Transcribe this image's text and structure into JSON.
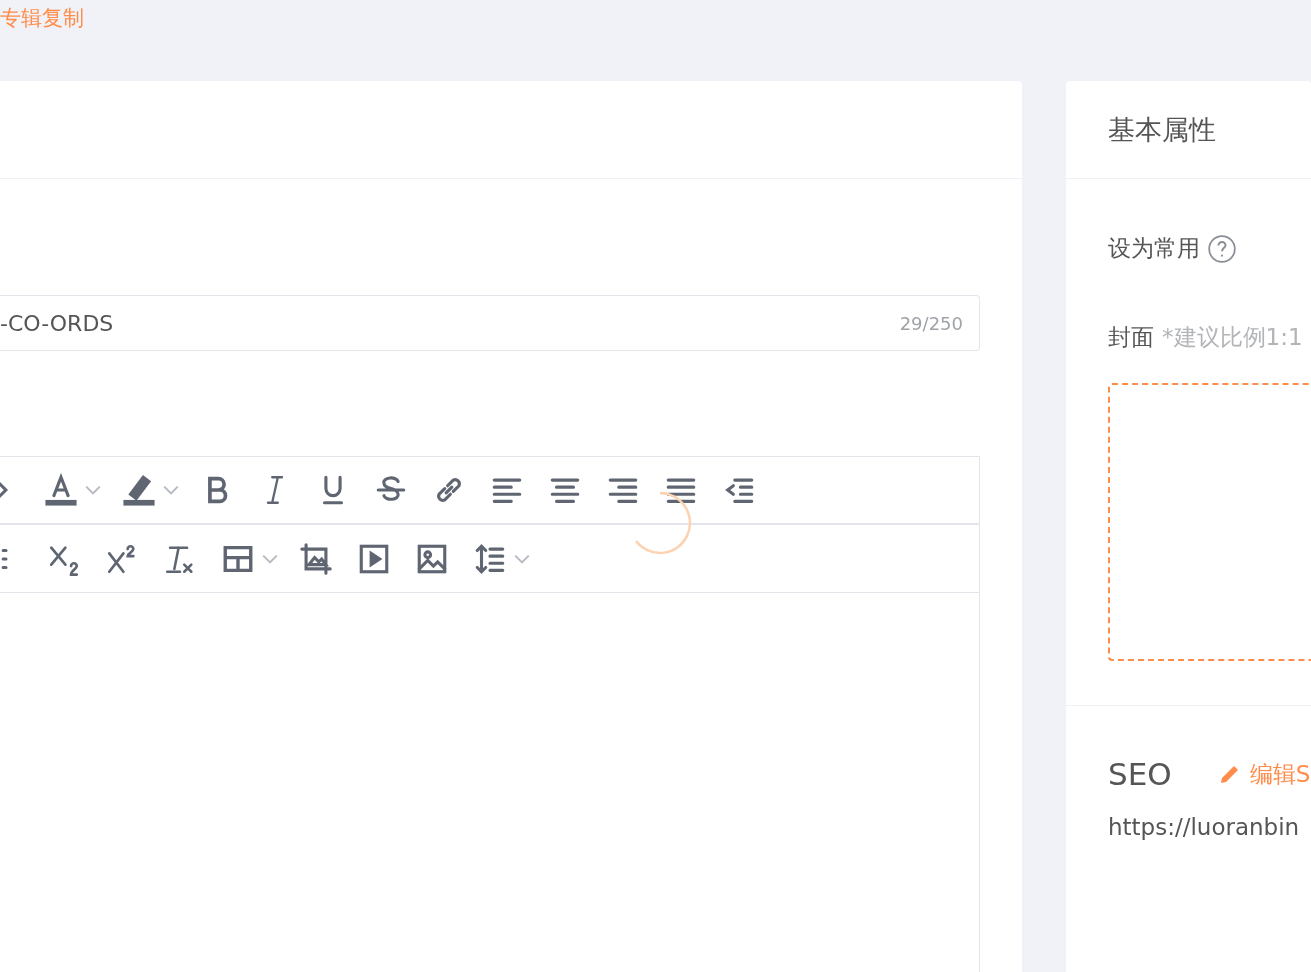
{
  "page_link": "专辑复制",
  "title_field": {
    "value": "-CO-ORDS",
    "counter": "29/250"
  },
  "side_panel": {
    "title": "基本属性",
    "favorite_label": "设为常用",
    "cover_label": "封面",
    "cover_hint": "*建议比例1:1",
    "seo_title": "SEO",
    "seo_edit": "编辑S",
    "seo_url": "https://luoranbin"
  }
}
